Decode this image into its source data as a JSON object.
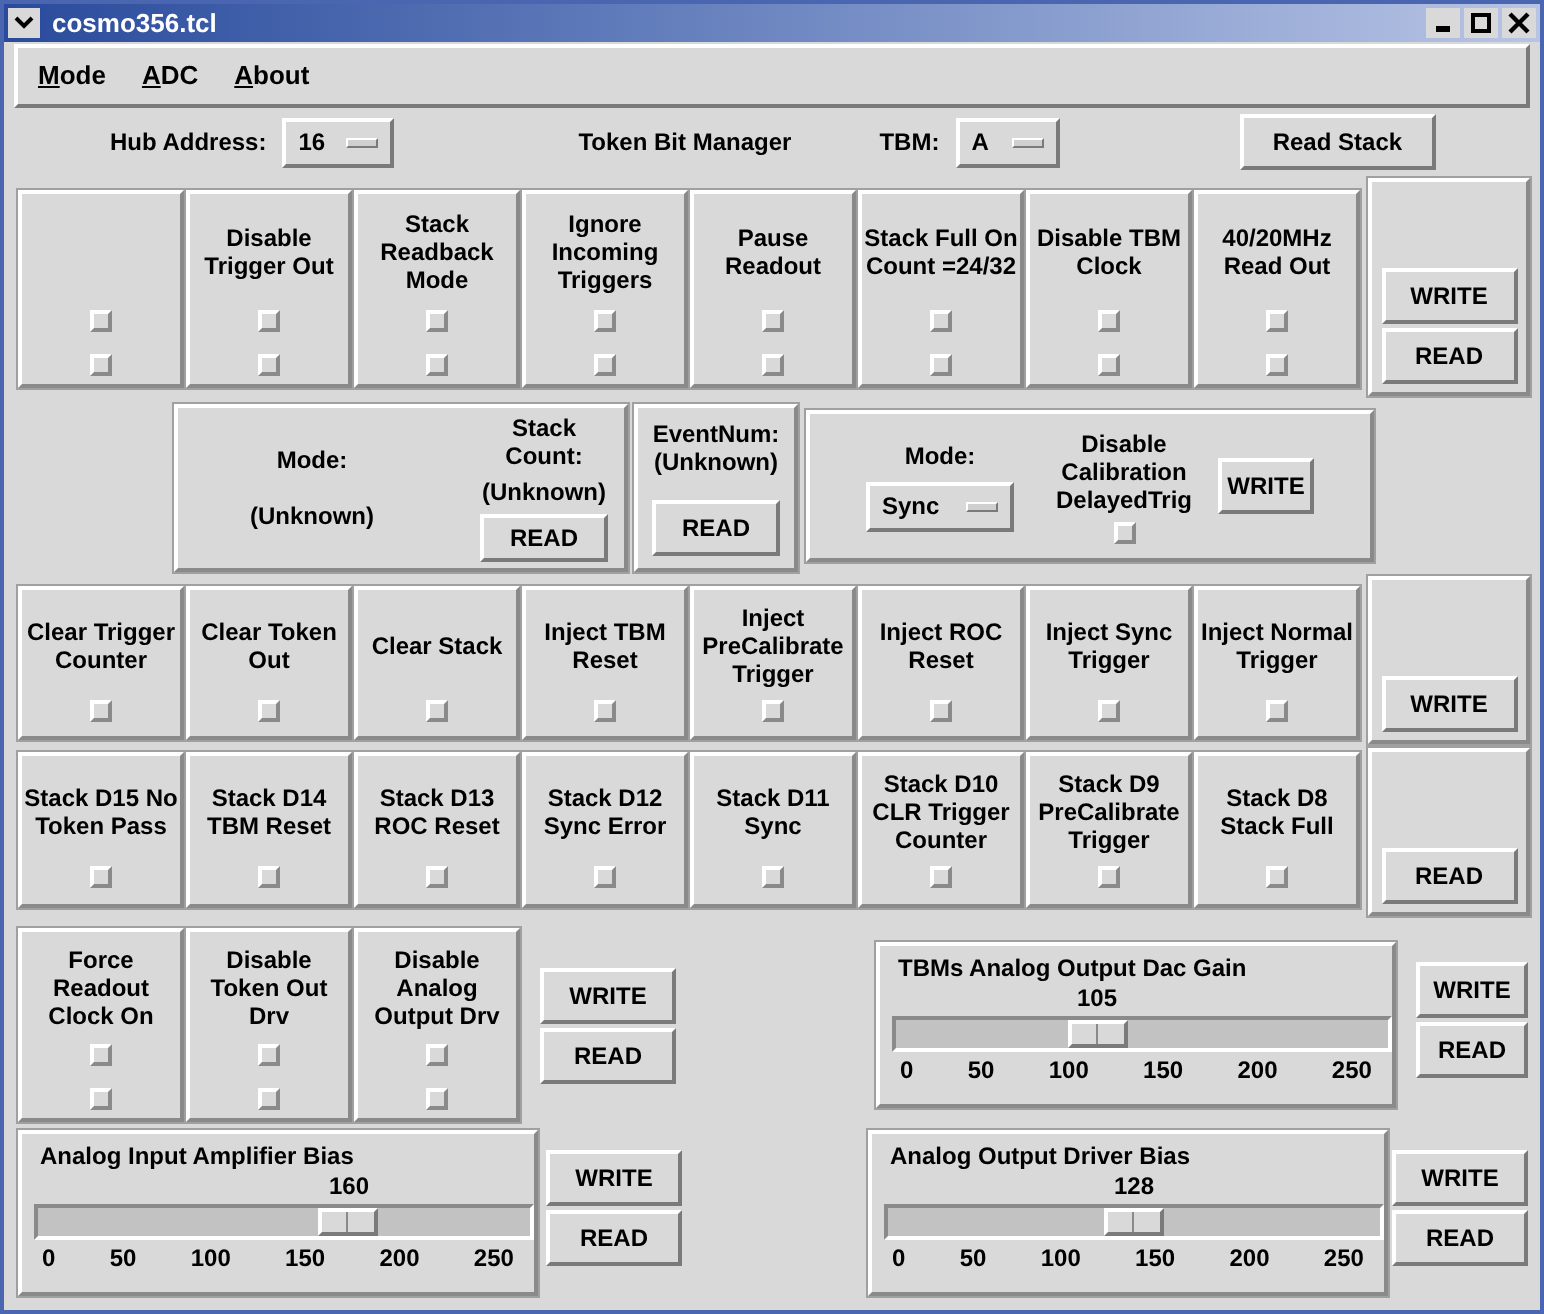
{
  "window": {
    "title": "cosmo356.tcl"
  },
  "menu": [
    {
      "label": "Mode",
      "underline_first": true
    },
    {
      "label": "ADC",
      "underline_first": true
    },
    {
      "label": "About",
      "underline_first": true
    }
  ],
  "header": {
    "hub_label": "Hub Address:",
    "hub_value": "16",
    "title": "Token Bit Manager",
    "tbm_label": "TBM:",
    "tbm_value": "A",
    "read_stack": "Read Stack"
  },
  "register_row": {
    "cells": [
      {
        "checks": [
          false,
          false
        ]
      },
      {
        "label": "Disable Trigger Out",
        "checks": [
          false,
          false
        ]
      },
      {
        "label": "Stack Readback Mode",
        "checks": [
          false,
          false
        ]
      },
      {
        "label": "Ignore Incoming Triggers",
        "checks": [
          false,
          false
        ]
      },
      {
        "label": "Pause Readout",
        "checks": [
          false,
          false
        ]
      },
      {
        "label": "Stack Full On Count =24/32",
        "checks": [
          false,
          false
        ]
      },
      {
        "label": "Disable TBM Clock",
        "checks": [
          false,
          false
        ]
      },
      {
        "label": "40/20MHz Read Out",
        "checks": [
          false,
          false
        ]
      }
    ],
    "buttons": [
      "WRITE",
      "READ"
    ]
  },
  "status": {
    "mode_label": "Mode:",
    "mode_value": "(Unknown)",
    "count_label": "Stack Count:",
    "count_value": "(Unknown)",
    "button": "READ"
  },
  "event": {
    "label": "EventNum:",
    "value": "(Unknown)",
    "button": "READ"
  },
  "mode_panel": {
    "label": "Mode:",
    "value": "Sync",
    "check_label": "Disable Calibration DelayedTrig",
    "checked": false,
    "button": "WRITE"
  },
  "inject_row": {
    "cells": [
      {
        "label": "Clear Trigger Counter",
        "checks": [
          false
        ]
      },
      {
        "label": "Clear Token Out",
        "checks": [
          false
        ]
      },
      {
        "label": "Clear Stack",
        "checks": [
          false
        ]
      },
      {
        "label": "Inject TBM Reset",
        "checks": [
          false
        ]
      },
      {
        "label": "Inject PreCalibrate Trigger",
        "checks": [
          false
        ]
      },
      {
        "label": "Inject ROC Reset",
        "checks": [
          false
        ]
      },
      {
        "label": "Inject Sync Trigger",
        "checks": [
          false
        ]
      },
      {
        "label": "Inject Normal Trigger",
        "checks": [
          false
        ]
      }
    ],
    "buttons": [
      "WRITE"
    ]
  },
  "stack_row": {
    "cells": [
      {
        "label": "Stack D15 No Token Pass",
        "checks": [
          false
        ]
      },
      {
        "label": "Stack D14 TBM Reset",
        "checks": [
          false
        ]
      },
      {
        "label": "Stack D13 ROC Reset",
        "checks": [
          false
        ]
      },
      {
        "label": "Stack D12 Sync Error",
        "checks": [
          false
        ]
      },
      {
        "label": "Stack D11 Sync",
        "checks": [
          false
        ]
      },
      {
        "label": "Stack D10 CLR Trigger Counter",
        "checks": [
          false
        ]
      },
      {
        "label": "Stack D9 PreCalibrate Trigger",
        "checks": [
          false
        ]
      },
      {
        "label": "Stack D8 Stack Full",
        "checks": [
          false
        ]
      }
    ],
    "buttons": [
      "READ"
    ]
  },
  "driver_row": {
    "cells": [
      {
        "label": "Force Readout Clock On",
        "checks": [
          false,
          false
        ]
      },
      {
        "label": "Disable Token Out Drv",
        "checks": [
          false,
          false
        ]
      },
      {
        "label": "Disable Analog Output Drv",
        "checks": [
          false,
          false
        ]
      }
    ],
    "buttons": [
      "WRITE",
      "READ"
    ]
  },
  "sliders": [
    {
      "title": "TBMs Analog Output Dac Gain",
      "value": "105",
      "level": 0.41,
      "ticks": [
        "0",
        "50",
        "100",
        "150",
        "200",
        "250"
      ],
      "buttons": [
        "WRITE",
        "READ"
      ]
    },
    {
      "title": "Analog Input Amplifier Bias",
      "value": "160",
      "level": 0.63,
      "ticks": [
        "0",
        "50",
        "100",
        "150",
        "200",
        "250"
      ],
      "buttons": [
        "WRITE",
        "READ"
      ]
    },
    {
      "title": "Analog Output Driver Bias",
      "value": "128",
      "level": 0.5,
      "ticks": [
        "0",
        "50",
        "100",
        "150",
        "200",
        "250"
      ],
      "buttons": [
        "WRITE",
        "READ"
      ]
    }
  ]
}
